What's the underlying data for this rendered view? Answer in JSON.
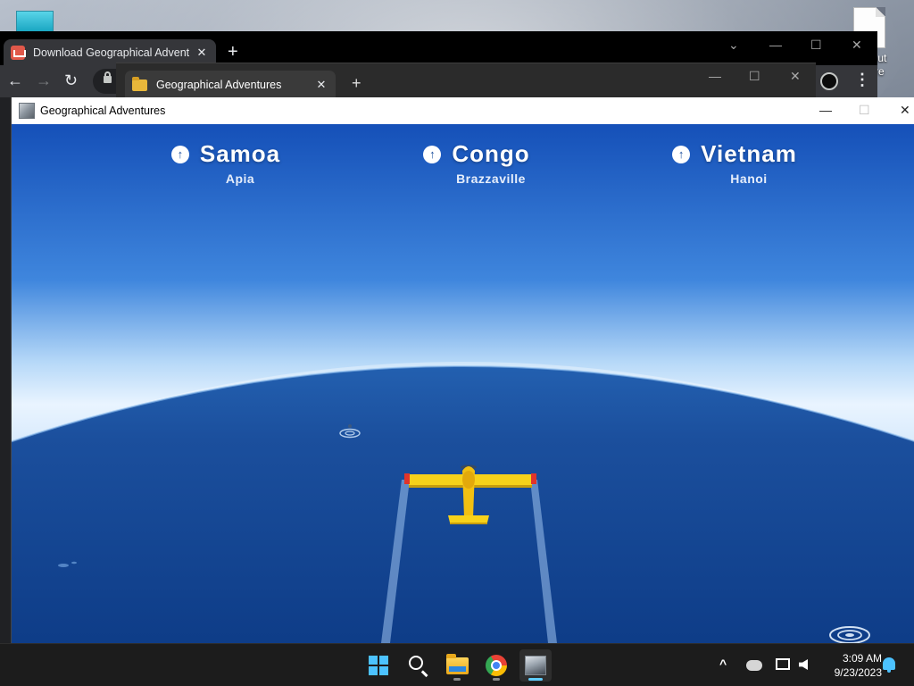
{
  "desktop": {
    "icon_label_partial": "bout\nture"
  },
  "browser": {
    "tab_title": "Download Geographical Advent",
    "tab_close": "✕",
    "new_tab": "+",
    "minimize": "—",
    "maximize": "☐",
    "close": "✕",
    "chevron": "⌄",
    "back": "←",
    "forward": "→",
    "reload": "↻",
    "menu": "⋮"
  },
  "explorer": {
    "tab_title": "Geographical Adventures",
    "tab_close": "✕",
    "new_tab": "+",
    "minimize": "—",
    "maximize": "☐",
    "close": "✕"
  },
  "game_window": {
    "title": "Geographical Adventures",
    "minimize": "—",
    "maximize": "☐",
    "close": "✕",
    "destinations": [
      {
        "country": "Samoa",
        "capital": "Apia",
        "arrow": "↑"
      },
      {
        "country": "Congo",
        "capital": "Brazzaville",
        "arrow": "↑"
      },
      {
        "country": "Vietnam",
        "capital": "Hanoi",
        "arrow": "↑"
      }
    ],
    "colors": {
      "sky_top": "#1550b8",
      "sky_horizon": "#e9f4ff",
      "ocean": "#1b4f9d",
      "plane": "#f7d21a"
    }
  },
  "taskbar": {
    "apps": [
      "start-icon",
      "search-icon",
      "file-explorer-icon",
      "chrome-icon",
      "geographical-adventures-icon"
    ],
    "tray_chevron": "^",
    "time": "3:09 AM",
    "date": "9/23/2023"
  }
}
